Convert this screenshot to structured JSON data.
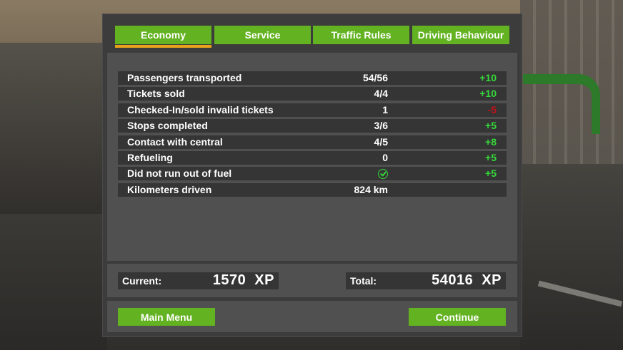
{
  "tabs": [
    {
      "label": "Economy",
      "active": true
    },
    {
      "label": "Service",
      "active": false
    },
    {
      "label": "Traffic Rules",
      "active": false
    },
    {
      "label": "Driving Behaviour",
      "active": false
    }
  ],
  "stats": [
    {
      "label": "Passengers transported",
      "value": "54/56",
      "points": "+10",
      "sign": "pos"
    },
    {
      "label": "Tickets sold",
      "value": "4/4",
      "points": "+10",
      "sign": "pos"
    },
    {
      "label": "Checked-In/sold invalid tickets",
      "value": "1",
      "points": "-5",
      "sign": "neg"
    },
    {
      "label": "Stops completed",
      "value": "3/6",
      "points": "+5",
      "sign": "pos"
    },
    {
      "label": "Contact with central",
      "value": "4/5",
      "points": "+8",
      "sign": "pos"
    },
    {
      "label": "Refueling",
      "value": "0",
      "points": "+5",
      "sign": "pos"
    },
    {
      "label": "Did not run out of fuel",
      "value_icon": "checkmark-circle-icon",
      "points": "+5",
      "sign": "pos"
    },
    {
      "label": "Kilometers driven",
      "value": "824 km",
      "points": "",
      "sign": ""
    }
  ],
  "xp": {
    "current_label": "Current:",
    "current_value": "1570  XP",
    "total_label": "Total:",
    "total_value": "54016  XP"
  },
  "buttons": {
    "main_menu": "Main Menu",
    "continue": "Continue"
  },
  "colors": {
    "accent_green": "#63b221",
    "positive": "#35d93a",
    "negative": "#c1121a",
    "tab_underline": "#e8a21a"
  }
}
